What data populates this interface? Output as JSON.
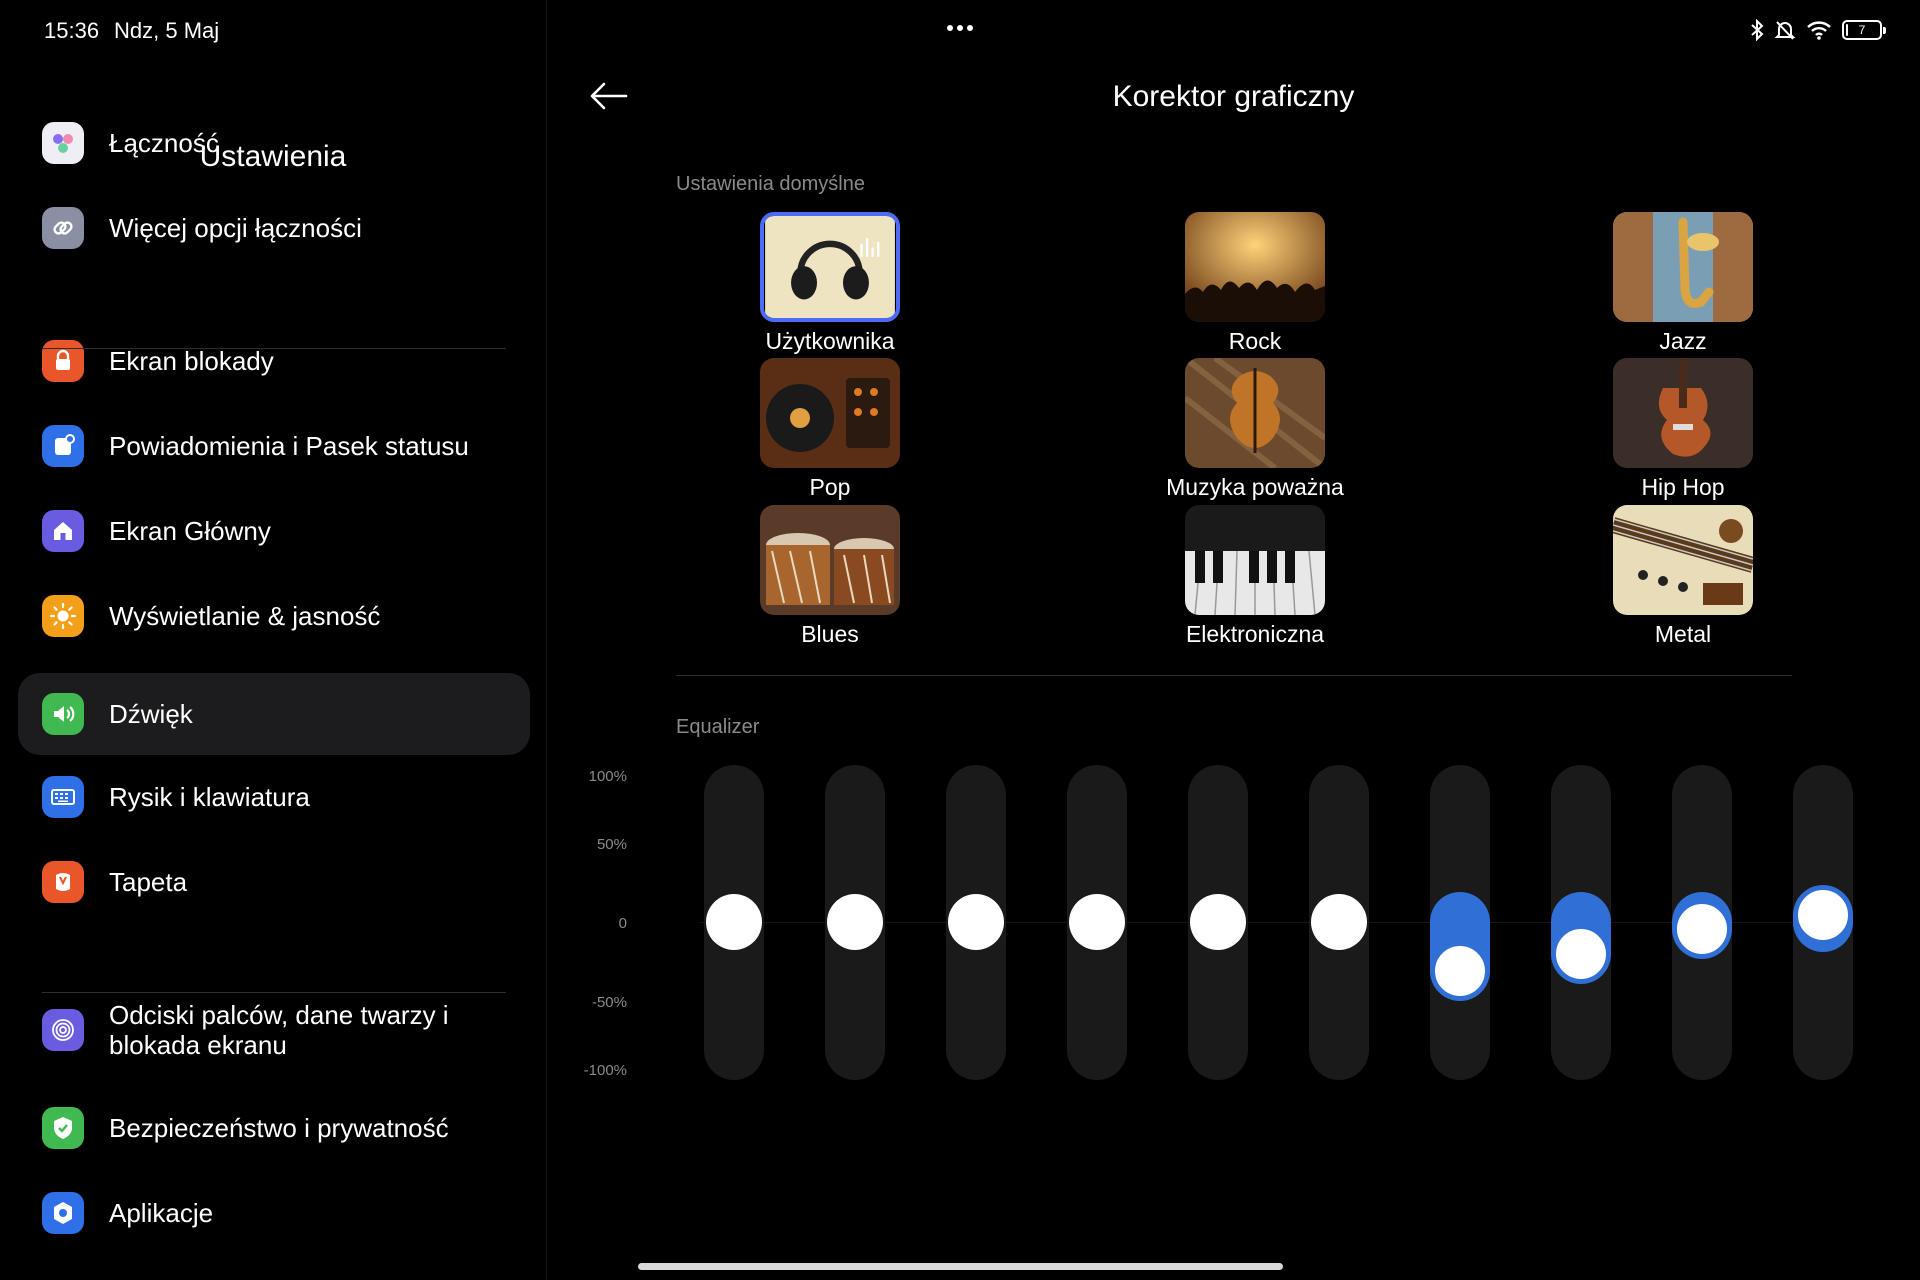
{
  "status": {
    "time": "15:36",
    "date": "Ndz, 5 Maj",
    "battery_level": "7",
    "battery_fraction": 0.07
  },
  "left": {
    "title": "Ustawienia",
    "items": [
      {
        "label": "Łączność",
        "icon": "connectivity-icon",
        "color": "#f0eef5"
      },
      {
        "label": "Więcej opcji łączności",
        "icon": "link-icon",
        "color": "#8b8fa3"
      },
      {
        "label": "Ekran blokady",
        "icon": "lock-icon",
        "color": "#e8562a"
      },
      {
        "label": "Powiadomienia i Pasek statusu",
        "icon": "notification-icon",
        "color": "#2f6fe8"
      },
      {
        "label": "Ekran Główny",
        "icon": "home-icon",
        "color": "#6a5ce0"
      },
      {
        "label": "Wyświetlanie & jasność",
        "icon": "sun-icon",
        "color": "#f2a01a"
      },
      {
        "label": "Dźwięk",
        "icon": "speaker-icon",
        "color": "#3fb950",
        "active": true
      },
      {
        "label": "Rysik i klawiatura",
        "icon": "keyboard-icon",
        "color": "#2f6fe8"
      },
      {
        "label": "Tapeta",
        "icon": "wallpaper-icon",
        "color": "#e8562a"
      },
      {
        "label": "Odciski palców, dane twarzy i blokada ekranu",
        "icon": "fingerprint-icon",
        "color": "#6a5ce0"
      },
      {
        "label": "Bezpieczeństwo i prywatność",
        "icon": "shield-icon",
        "color": "#3fb950"
      },
      {
        "label": "Aplikacje",
        "icon": "apps-icon",
        "color": "#2f6fe8"
      }
    ]
  },
  "right": {
    "title": "Korektor graficzny",
    "presets_heading": "Ustawienia domyślne",
    "presets": [
      {
        "label": "Użytkownika",
        "selected": true,
        "icon": "headphones-icon"
      },
      {
        "label": "Rock",
        "icon": "concert-icon"
      },
      {
        "label": "Jazz",
        "icon": "saxophone-icon"
      },
      {
        "label": "Pop",
        "icon": "turntable-icon"
      },
      {
        "label": "Muzyka poważna",
        "icon": "violin-icon"
      },
      {
        "label": "Hip Hop",
        "icon": "guitar-icon"
      },
      {
        "label": "Blues",
        "icon": "drums-icon"
      },
      {
        "label": "Elektroniczna",
        "icon": "piano-keys-icon"
      },
      {
        "label": "Metal",
        "icon": "electric-guitar-icon"
      }
    ],
    "eq_heading": "Equalizer",
    "eq_ticks": [
      "100%",
      "50%",
      "0",
      "-50%",
      "-100%"
    ],
    "eq_bands": [
      0,
      0,
      0,
      0,
      0,
      0,
      -33,
      -22,
      -5,
      5
    ],
    "accent": "#2f6fd6"
  }
}
